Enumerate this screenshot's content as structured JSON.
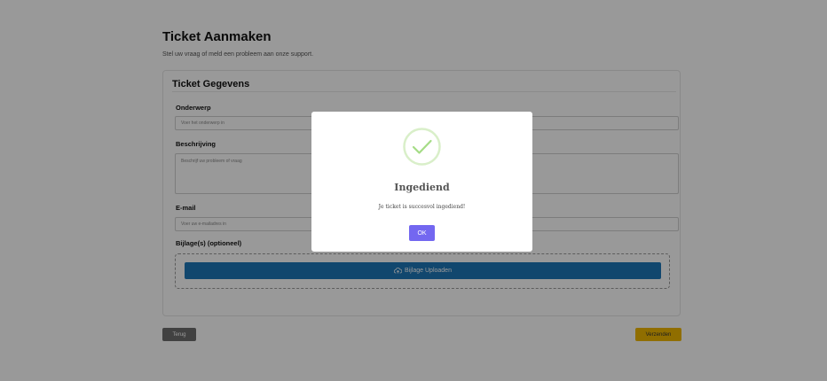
{
  "page": {
    "title": "Ticket Aanmaken",
    "subtitle": "Stel uw vraag of meld een probleem aan onze support."
  },
  "form": {
    "section_title": "Ticket Gegevens",
    "subject": {
      "label": "Onderwerp",
      "placeholder": "Voer het onderwerp in",
      "value": ""
    },
    "description": {
      "label": "Beschrijving",
      "placeholder": "Beschrijf uw probleem of vraag",
      "value": ""
    },
    "email": {
      "label": "E-mail",
      "placeholder": "Voer uw e-mailadres in",
      "value": ""
    },
    "attachments": {
      "label": "Bijlage(s) (optioneel)",
      "upload_label": "Bijlage Uploaden",
      "upload_icon": "cloud-upload-icon"
    }
  },
  "actions": {
    "back_label": "Terug",
    "submit_label": "Verzenden"
  },
  "modal": {
    "icon": "success-check-icon",
    "title": "Ingediend",
    "message": "Je ticket is succesvol ingediend!",
    "ok_label": "OK"
  },
  "colors": {
    "upload_button": "#1d77b8",
    "back_button": "#6d6d6d",
    "submit_button": "#f0b800",
    "ok_button": "#7367f0",
    "success_icon": "#a5dc86"
  }
}
